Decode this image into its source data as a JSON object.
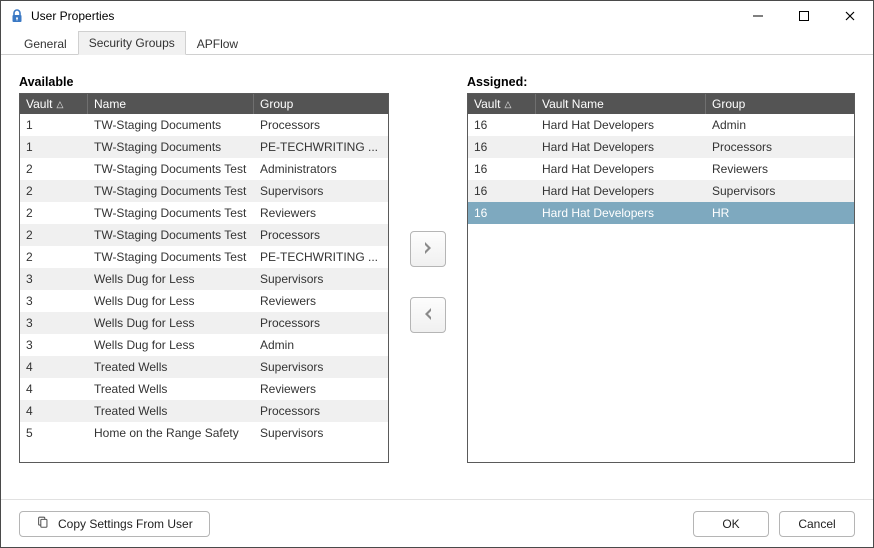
{
  "titlebar": {
    "title": "User Properties"
  },
  "tabs": {
    "items": [
      {
        "label": "General"
      },
      {
        "label": "Security Groups"
      },
      {
        "label": "APFlow"
      }
    ],
    "active_index": 1
  },
  "available": {
    "label": "Available",
    "headers": {
      "vault": "Vault",
      "name": "Name",
      "group": "Group"
    },
    "rows": [
      {
        "vault": "1",
        "name": "TW-Staging Documents",
        "group": "Processors"
      },
      {
        "vault": "1",
        "name": "TW-Staging Documents",
        "group": "PE-TECHWRITING ..."
      },
      {
        "vault": "2",
        "name": "TW-Staging Documents Test",
        "group": "Administrators"
      },
      {
        "vault": "2",
        "name": "TW-Staging Documents Test",
        "group": "Supervisors"
      },
      {
        "vault": "2",
        "name": "TW-Staging Documents Test",
        "group": "Reviewers"
      },
      {
        "vault": "2",
        "name": "TW-Staging Documents Test",
        "group": "Processors"
      },
      {
        "vault": "2",
        "name": "TW-Staging Documents Test",
        "group": "PE-TECHWRITING ..."
      },
      {
        "vault": "3",
        "name": "Wells Dug for Less",
        "group": "Supervisors"
      },
      {
        "vault": "3",
        "name": "Wells Dug for Less",
        "group": "Reviewers"
      },
      {
        "vault": "3",
        "name": "Wells Dug for Less",
        "group": "Processors"
      },
      {
        "vault": "3",
        "name": "Wells Dug for Less",
        "group": "Admin"
      },
      {
        "vault": "4",
        "name": "Treated Wells",
        "group": "Supervisors"
      },
      {
        "vault": "4",
        "name": "Treated Wells",
        "group": "Reviewers"
      },
      {
        "vault": "4",
        "name": "Treated Wells",
        "group": "Processors"
      },
      {
        "vault": "5",
        "name": "Home on the Range Safety",
        "group": "Supervisors"
      }
    ]
  },
  "assigned": {
    "label": "Assigned:",
    "headers": {
      "vault": "Vault",
      "name": "Vault Name",
      "group": "Group"
    },
    "rows": [
      {
        "vault": "16",
        "name": "Hard Hat Developers",
        "group": "Admin",
        "selected": false
      },
      {
        "vault": "16",
        "name": "Hard Hat Developers",
        "group": "Processors",
        "selected": false
      },
      {
        "vault": "16",
        "name": "Hard Hat Developers",
        "group": "Reviewers",
        "selected": false
      },
      {
        "vault": "16",
        "name": "Hard Hat Developers",
        "group": "Supervisors",
        "selected": false
      },
      {
        "vault": "16",
        "name": "Hard Hat Developers",
        "group": "HR",
        "selected": true
      }
    ]
  },
  "footer": {
    "copy_label": "Copy Settings From User",
    "ok_label": "OK",
    "cancel_label": "Cancel"
  }
}
